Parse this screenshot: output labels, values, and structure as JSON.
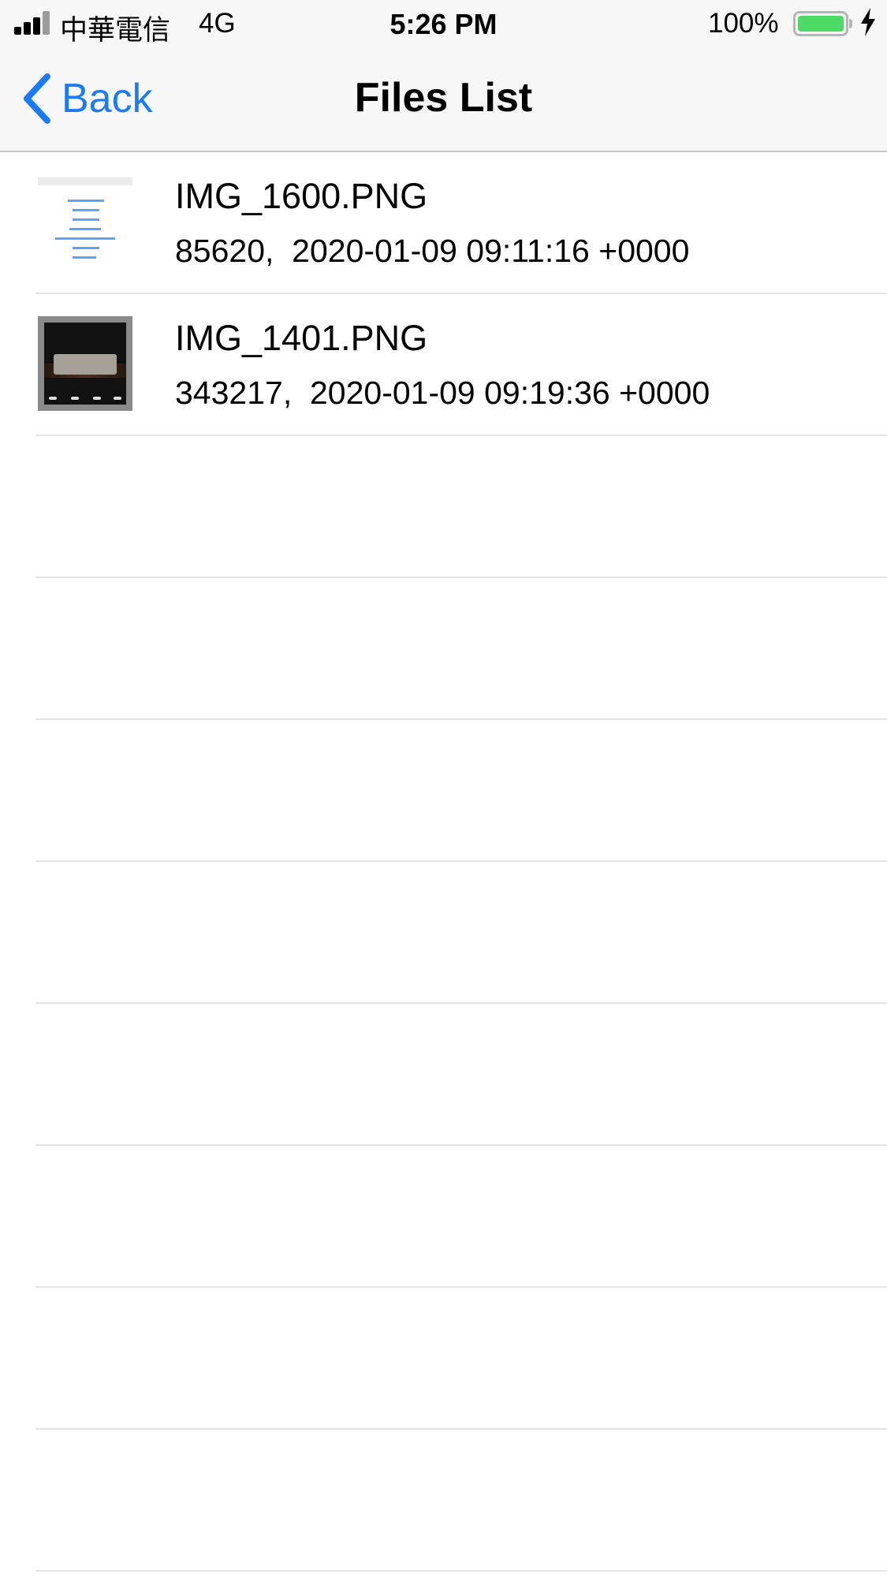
{
  "status_bar": {
    "carrier": "中華電信",
    "network": "4G",
    "time": "5:26 PM",
    "battery_percent": "100%",
    "battery_level": 1.0,
    "battery_color": "#4cd964",
    "charging_icon": "bolt-icon",
    "signal_bars": 4
  },
  "nav": {
    "back_label": "Back",
    "back_icon": "chevron-left-icon",
    "title": "Files List",
    "accent_color": "#1a7cf5"
  },
  "files": [
    {
      "name": "IMG_1600.PNG",
      "meta": "85620,  2020-01-09 09:11:16 +0000"
    },
    {
      "name": "IMG_1401.PNG",
      "meta": "343217,  2020-01-09 09:19:36 +0000"
    }
  ]
}
